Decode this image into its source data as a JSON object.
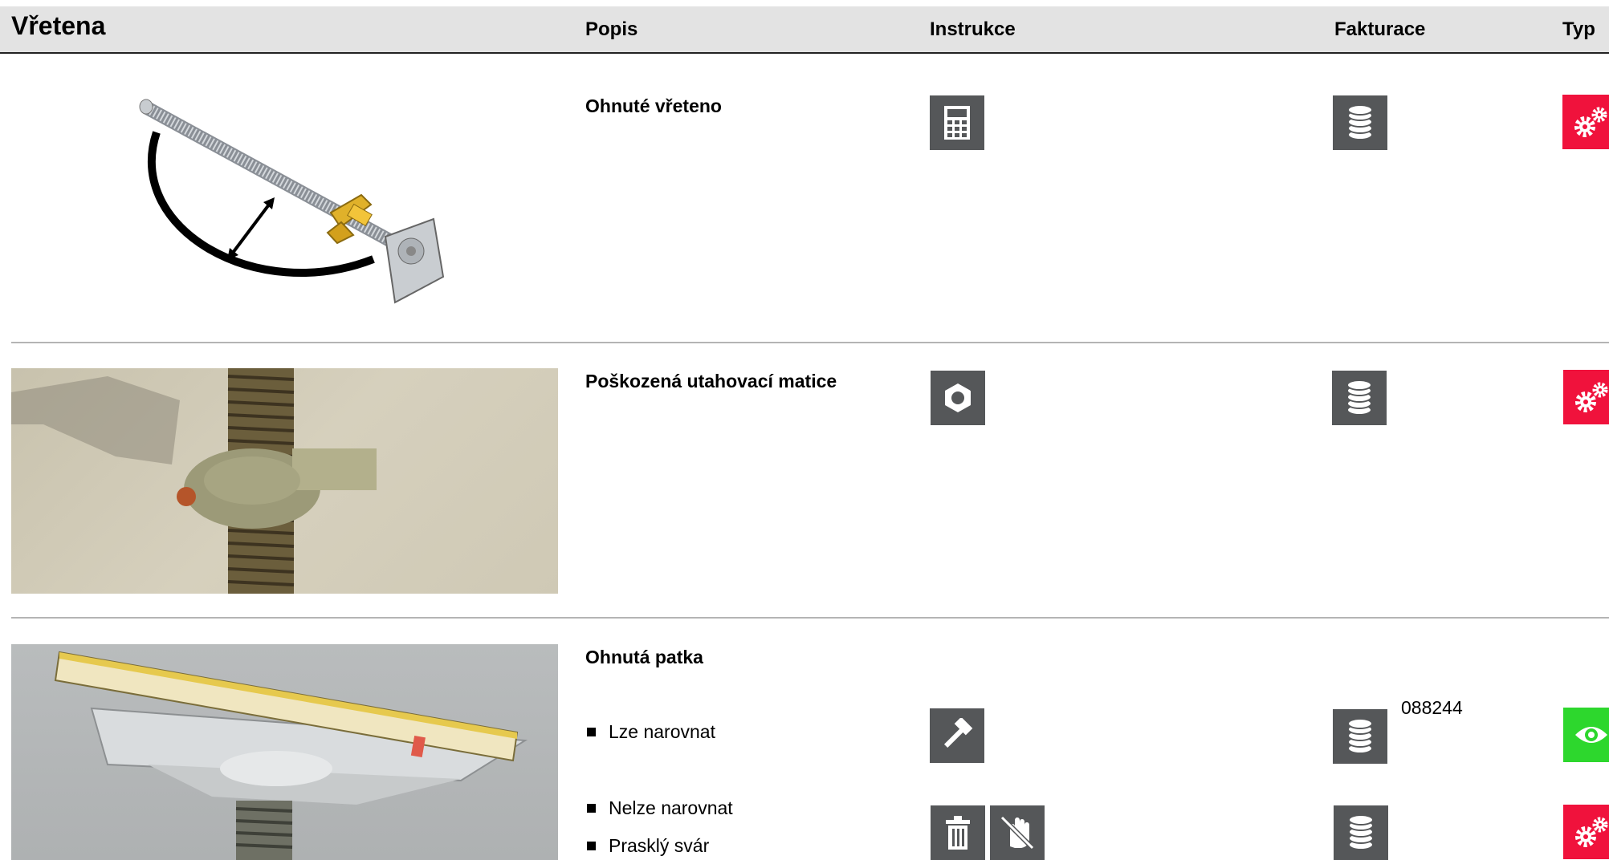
{
  "header": {
    "title": "Vřetena",
    "columns": {
      "popis": "Popis",
      "instrukce": "Instrukce",
      "fakturace": "Fakturace",
      "typ": "Typ"
    }
  },
  "rows": [
    {
      "description": "Ohnuté vřeteno",
      "image": "bent-spindle-illustration",
      "instruction_icon": "calculator-icon",
      "billing_icon": "coins-icon",
      "type_icon": "gears-icon",
      "type_color": "#f0123c"
    },
    {
      "description": "Poškozená utahovací matice",
      "image": "damaged-nut-photo",
      "instruction_icon": "broken-nut-icon",
      "billing_icon": "coins-icon",
      "type_icon": "gears-icon",
      "type_color": "#f0123c"
    },
    {
      "description": "Ohnutá patka",
      "image": "bent-base-plate-photo",
      "items": [
        {
          "label": "Lze narovnat",
          "instruction_icons": [
            "hammer-icon"
          ],
          "billing_icon": "coins-icon",
          "code": "088244",
          "type_icon": "eye-icon",
          "type_color": "#2dd72d"
        },
        {
          "label": "Nelze narovnat",
          "instruction_icons": [
            "trash-icon",
            "no-hand-icon"
          ],
          "billing_icon": "coins-icon",
          "type_icon": "gears-icon",
          "type_color": "#f0123c"
        },
        {
          "label": "Prasklý svár"
        }
      ]
    }
  ]
}
